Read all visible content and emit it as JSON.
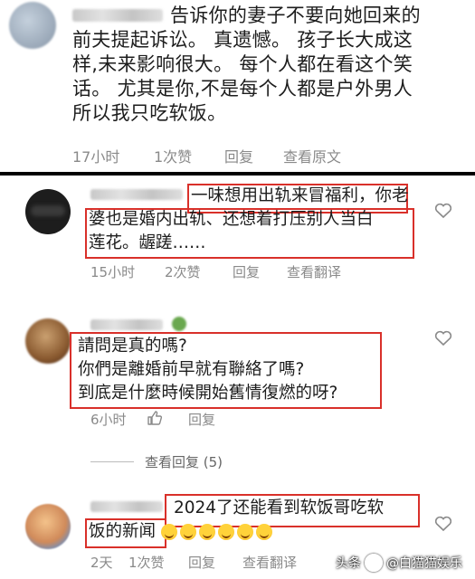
{
  "comment1": {
    "lines": [
      "告诉你的妻子不要向她回来的",
      "前夫提起诉讼。 真遗憾。 孩子长大成这",
      "样,未来影响很大。 每个人都在看这个笑",
      "话。 尤其是你,不是每个人都是户外男人",
      "所以我只吃软饭。"
    ],
    "time": "17小时",
    "likes": "1次赞",
    "reply": "回复",
    "view_original": "查看原文"
  },
  "comment2": {
    "lines": [
      "一味想用出轨来冒福利，你老",
      "婆也是婚内出轨、还想着打压别人当白",
      "莲花。龌蹉……"
    ],
    "time": "15小时",
    "likes": "2次赞",
    "reply": "回复",
    "translate": "查看翻译"
  },
  "comment3": {
    "lines": [
      "請問是真的嗎?",
      "你們是離婚前早就有聯絡了嗎?",
      "到底是什麼時候開始舊情復燃的呀?"
    ],
    "time": "6小时",
    "reply": "回复",
    "view_replies": "查看回复 (5)"
  },
  "comment4": {
    "line1": "2024了还能看到软饭哥吃软",
    "line2": "饭的新闻",
    "time": "2天",
    "likes": "1次赞",
    "reply": "回复",
    "translate": "查看翻译"
  },
  "watermark": {
    "prefix": "头条",
    "handle": "@白猫猫娱乐"
  },
  "colors": {
    "highlight_box": "#d9302a",
    "meta_text": "#8a8a8a",
    "divider": "#000000"
  }
}
